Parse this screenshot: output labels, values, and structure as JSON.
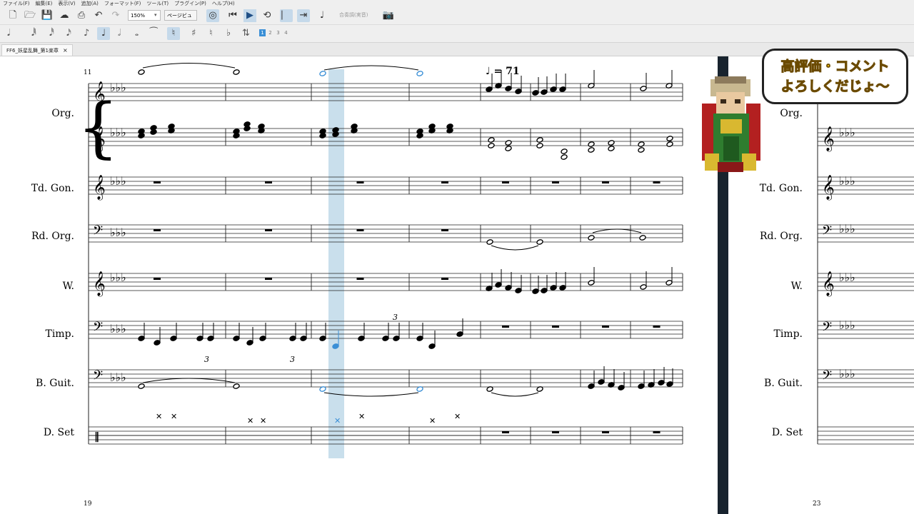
{
  "menu": [
    "ファイル(F)",
    "編集(E)",
    "表示(V)",
    "追加(A)",
    "フォーマット(F)",
    "ツール(T)",
    "プラグイン(P)",
    "ヘルプ(H)"
  ],
  "toolbar": {
    "zoom": "150%",
    "view_mode": "ページビュー",
    "concert_pitch": "合奏調(実音)"
  },
  "voice_tabs": [
    "1",
    "2",
    "3",
    "4"
  ],
  "tab": {
    "title": "FF6_妖星乱舞_第1楽章",
    "close": "×"
  },
  "score": {
    "measure_number_top": "11",
    "measure_number_bottom": "19",
    "measure_number_bottom_right": "23",
    "tempo": "♩ = 71",
    "tuplet": "3",
    "instruments": [
      "Org.",
      "Td. Gon.",
      "Rd. Org.",
      "W.",
      "Timp.",
      "B. Guit.",
      "D. Set"
    ],
    "right_instruments": [
      "Org.",
      "Td. Gon.",
      "Rd. Org.",
      "W.",
      "Timp.",
      "B. Guit.",
      "D. Set"
    ]
  },
  "overlay": {
    "line1": "高評価・コメント",
    "line2": "よろしくだじょ〜"
  },
  "colors": {
    "selection": "#b7d4e6",
    "accent": "#3a8fd6",
    "bubble_text": "#f2c200"
  }
}
